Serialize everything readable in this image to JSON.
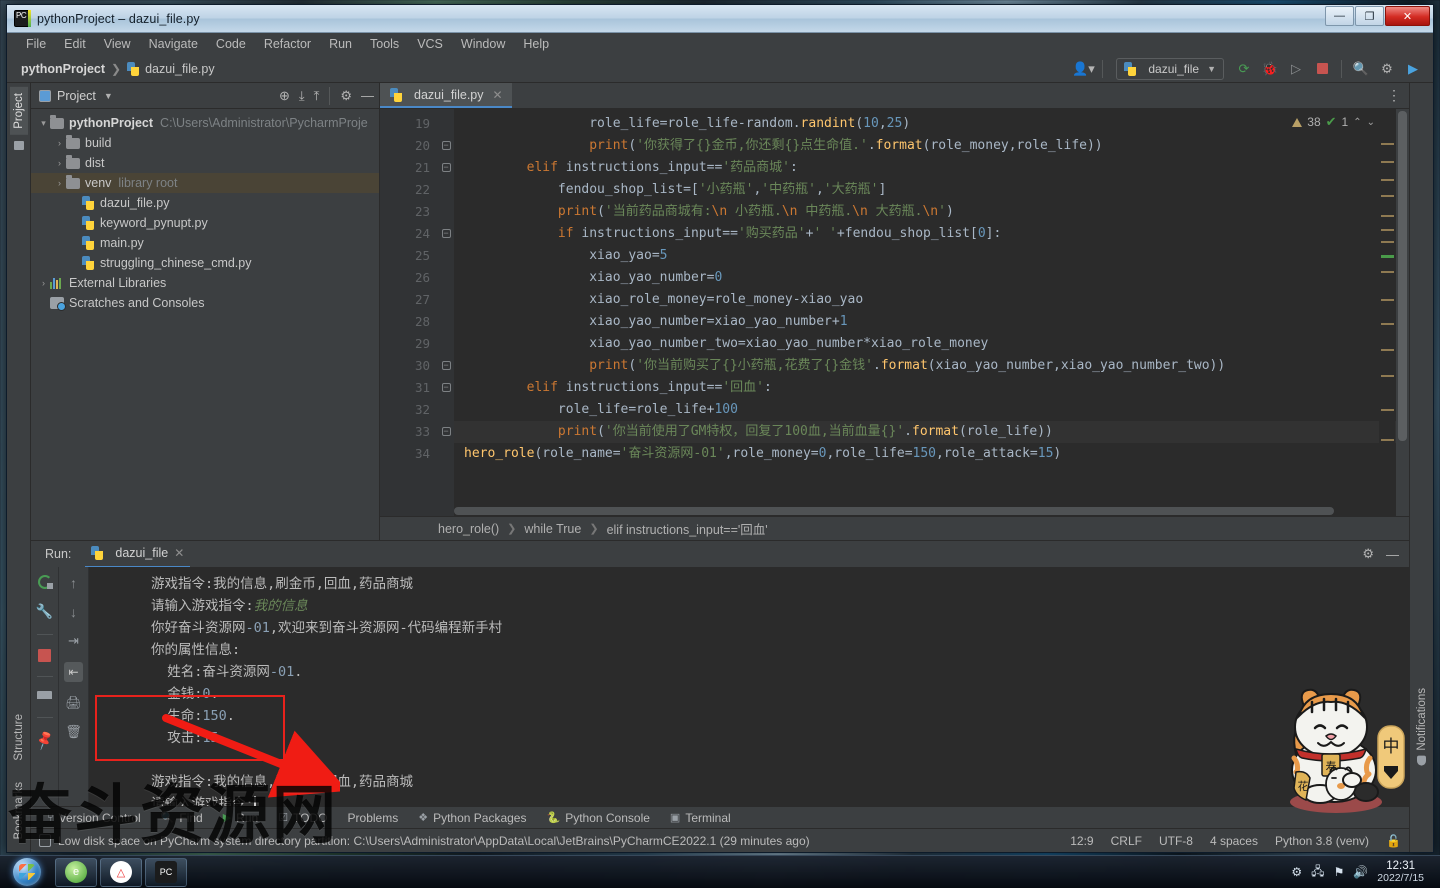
{
  "titlebar": {
    "title": "pythonProject – dazui_file.py",
    "minimize": "—",
    "maximize": "❐",
    "close": "✕"
  },
  "menubar": {
    "items": [
      "File",
      "Edit",
      "View",
      "Navigate",
      "Code",
      "Refactor",
      "Run",
      "Tools",
      "VCS",
      "Window",
      "Help"
    ]
  },
  "navbar": {
    "project": "pythonProject",
    "file": "dazui_file.py",
    "run_config": "dazui_file",
    "icons": {
      "profile": "profile-icon",
      "run": "run-icon",
      "debug": "debug-icon",
      "coverage": "coverage-icon",
      "stop": "stop-icon",
      "search": "search-icon",
      "settings": "gear-icon",
      "updates": "updates-icon"
    }
  },
  "left_rail": {
    "project": "Project",
    "structure": "Structure",
    "bookmarks": "Bookmarks"
  },
  "right_rail": {
    "notifications": "Notifications"
  },
  "project_pane": {
    "title": "Project",
    "tree": [
      {
        "indent": 0,
        "arrow": "▾",
        "icon": "folder",
        "label": "pythonProject",
        "bold": true,
        "meta": "C:\\Users\\Administrator\\PycharmProje",
        "selected": false
      },
      {
        "indent": 1,
        "arrow": "›",
        "icon": "folder",
        "label": "build",
        "bold": false,
        "meta": "",
        "selected": false
      },
      {
        "indent": 1,
        "arrow": "›",
        "icon": "folder",
        "label": "dist",
        "bold": false,
        "meta": "",
        "selected": false
      },
      {
        "indent": 1,
        "arrow": "›",
        "icon": "folder",
        "label": "venv",
        "bold": false,
        "meta": "library root",
        "selected": true
      },
      {
        "indent": 2,
        "arrow": "",
        "icon": "py",
        "label": "dazui_file.py",
        "bold": false,
        "meta": "",
        "selected": false
      },
      {
        "indent": 2,
        "arrow": "",
        "icon": "py",
        "label": "keyword_pynupt.py",
        "bold": false,
        "meta": "",
        "selected": false
      },
      {
        "indent": 2,
        "arrow": "",
        "icon": "py",
        "label": "main.py",
        "bold": false,
        "meta": "",
        "selected": false
      },
      {
        "indent": 2,
        "arrow": "",
        "icon": "py",
        "label": "struggling_chinese_cmd.py",
        "bold": false,
        "meta": "",
        "selected": false
      },
      {
        "indent": 0,
        "arrow": "›",
        "icon": "lib",
        "label": "External Libraries",
        "bold": false,
        "meta": "",
        "selected": false
      },
      {
        "indent": 0,
        "arrow": "",
        "icon": "scratch",
        "label": "Scratches and Consoles",
        "bold": false,
        "meta": "",
        "selected": false
      }
    ]
  },
  "editor": {
    "tab": "dazui_file.py",
    "inspection": {
      "warnings": "38",
      "checks": "1"
    },
    "lines": [
      {
        "num": "19",
        "fold": "",
        "current": false
      },
      {
        "num": "20",
        "fold": "minus",
        "current": false
      },
      {
        "num": "21",
        "fold": "minus",
        "current": false
      },
      {
        "num": "22",
        "fold": "",
        "current": false
      },
      {
        "num": "23",
        "fold": "",
        "current": false
      },
      {
        "num": "24",
        "fold": "minus",
        "current": false
      },
      {
        "num": "25",
        "fold": "",
        "current": false
      },
      {
        "num": "26",
        "fold": "",
        "current": false
      },
      {
        "num": "27",
        "fold": "",
        "current": false
      },
      {
        "num": "28",
        "fold": "",
        "current": false
      },
      {
        "num": "29",
        "fold": "",
        "current": false
      },
      {
        "num": "30",
        "fold": "minus",
        "current": false
      },
      {
        "num": "31",
        "fold": "minus",
        "current": false
      },
      {
        "num": "32",
        "fold": "",
        "current": false
      },
      {
        "num": "33",
        "fold": "minus",
        "current": true
      },
      {
        "num": "34",
        "fold": "",
        "current": false
      }
    ],
    "code": [
      "                role_life=role_life-random.randint(10,25)",
      "                print('你获得了{}金币,你还剩{}点生命值.'.format(role_money,role_life))",
      "        elif instructions_input=='药品商城':",
      "            fendou_shop_list=['小药瓶','中药瓶','大药瓶']",
      "            print('当前药品商城有:\\n 小药瓶.\\n 中药瓶.\\n 大药瓶.\\n')",
      "            if instructions_input=='购买药品'+' '+fendou_shop_list[0]:",
      "                xiao_yao=5",
      "                xiao_yao_number=0",
      "                xiao_role_money=role_money-xiao_yao",
      "                xiao_yao_number=xiao_yao_number+1",
      "                xiao_yao_number_two=xiao_yao_number*xiao_role_money",
      "                print('你当前购买了{}小药瓶,花费了{}金钱'.format(xiao_yao_number,xiao_yao_number_two))",
      "        elif instructions_input=='回血':",
      "            role_life=role_life+100",
      "            print('你当前使用了GM特权，回复了100血,当前血量{}'.format(role_life))",
      "hero_role(role_name='奋斗资源网-01',role_money=0,role_life=150,role_attack=15)"
    ],
    "breadcrumbs": [
      "hero_role()",
      "while True",
      "elif instructions_input=='回血'"
    ]
  },
  "run_window": {
    "label": "Run:",
    "tab": "dazui_file",
    "console_lines": [
      "游戏指令:我的信息,刷金币,回血,药品商城",
      "请输入游戏指令:我的信息",
      "你好奋斗资源网-01,欢迎来到奋斗资源网-代码编程新手村",
      "你的属性信息:",
      "  姓名:奋斗资源网-01.",
      "  金钱:0.",
      "  生命:150.",
      "  攻击:15",
      "",
      "游戏指令:我的信息,刷金币,回血,药品商城",
      "请输入游戏指令:"
    ],
    "prompt_value": "我的信息",
    "tools": {
      "rerun": "rerun-icon",
      "settings": "wrench-icon",
      "stop": "stop-icon",
      "layout": "layout-icon",
      "pin": "pin-icon",
      "up": "arrow-up-icon",
      "down": "arrow-down-icon",
      "wrap": "soft-wrap-icon",
      "scroll_end": "scroll-to-end-icon",
      "print": "print-icon",
      "clear": "trash-icon"
    }
  },
  "bottom_toolbar": {
    "items": [
      "Version Control",
      "Find",
      "Run",
      "TODO",
      "Problems",
      "Python Packages",
      "Python Console",
      "Terminal"
    ]
  },
  "statusbar": {
    "left": "Low disk space on PyCharm system directory partition: C:\\Users\\Administrator\\AppData\\Local\\JetBrains\\PyCharmCE2022.1 (29 minutes ago)",
    "caret": "12:9",
    "line_sep": "CRLF",
    "encoding": "UTF-8",
    "indent": "4 spaces",
    "interpreter": "Python 3.8 (venv)"
  },
  "watermark": "奋斗资源网",
  "taskbar": {
    "start": "start-orb",
    "apps": [
      "ie-browser",
      "360-browser",
      "pycharm"
    ],
    "time": "12:31",
    "date": "2022/7/15"
  },
  "annotation": {
    "box": "red-highlight-box",
    "arrow": "red-arrow"
  },
  "colors": {
    "accent": "#4a88c7",
    "keyword": "#cc7832",
    "string": "#6a8759",
    "number": "#6897bb",
    "function": "#ffc66d",
    "annotation_red": "#e8221c",
    "editor_bg": "#2b2b2b",
    "panel_bg": "#3c3f41"
  }
}
